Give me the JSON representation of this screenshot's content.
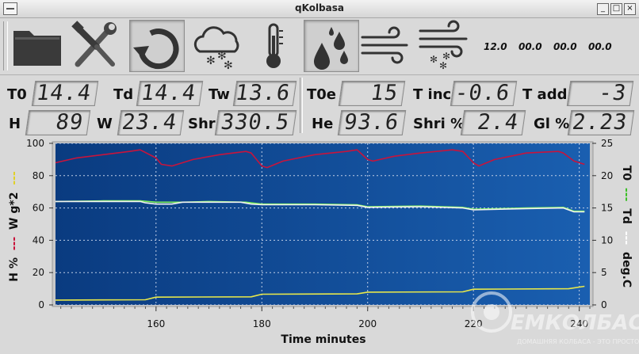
{
  "window": {
    "title": "qKolbasa"
  },
  "toolbar": {
    "buttons": [
      {
        "name": "open",
        "icon": "folder-icon"
      },
      {
        "name": "settings",
        "icon": "tools-icon"
      },
      {
        "name": "refresh",
        "icon": "refresh-icon",
        "pressed": true
      },
      {
        "name": "snow",
        "icon": "snow-cloud-icon"
      },
      {
        "name": "temperature",
        "icon": "thermometer-icon"
      },
      {
        "name": "humidity",
        "icon": "water-drops-icon",
        "pressed": true
      },
      {
        "name": "wind",
        "icon": "wind-icon"
      },
      {
        "name": "wind-snow",
        "icon": "wind-snow-icon"
      }
    ],
    "values": [
      "12.0",
      "00.0",
      "00.0",
      "00.0"
    ]
  },
  "readings": {
    "T0": {
      "label": "T0",
      "value": "14.4"
    },
    "Td": {
      "label": "Td",
      "value": "14.4"
    },
    "Tw": {
      "label": "Tw",
      "value": "13.6"
    },
    "T0e": {
      "label": "T0e",
      "value": "15"
    },
    "Tinc": {
      "label": "T inc",
      "value": "-0.6"
    },
    "Tadd": {
      "label": "T add",
      "value": "-3"
    },
    "H": {
      "label": "H",
      "value": "89"
    },
    "W": {
      "label": "W",
      "value": "23.4"
    },
    "Shr": {
      "label": "Shr",
      "value": "330.5"
    },
    "He": {
      "label": "He",
      "value": "93.6"
    },
    "ShriPct": {
      "label": "Shri %",
      "value": "2.4"
    },
    "GlPct": {
      "label": "Gl %",
      "value": "2.23"
    }
  },
  "colors": {
    "plot_bg": "#0b3f85",
    "humidity": "#c8143c",
    "temperature": "#7bef5a",
    "dew": "#f2f2f2",
    "weight": "#e8e84a"
  },
  "chart_data": {
    "type": "line",
    "xlabel": "Time minutes",
    "ylabel_left": [
      "H %",
      "---",
      "W g*2",
      "---"
    ],
    "ylabel_right": [
      "T0",
      "---",
      "Td",
      "---",
      "deg.C"
    ],
    "xlim": [
      141,
      242
    ],
    "ylim_left": [
      0,
      100
    ],
    "ylim_right": [
      0,
      25
    ],
    "x_ticks": [
      160,
      180,
      200,
      220,
      240
    ],
    "y_ticks_left": [
      0,
      20,
      40,
      60,
      80,
      100
    ],
    "y_ticks_right": [
      0,
      5,
      10,
      15,
      20,
      25
    ],
    "grid": true,
    "series": [
      {
        "key": "humidity",
        "axis": "left",
        "points": [
          [
            141,
            88
          ],
          [
            145,
            91
          ],
          [
            150,
            93
          ],
          [
            155,
            95
          ],
          [
            157,
            96
          ],
          [
            160,
            91
          ],
          [
            161,
            87
          ],
          [
            163,
            86
          ],
          [
            167,
            90
          ],
          [
            172,
            93
          ],
          [
            177,
            95
          ],
          [
            178,
            94
          ],
          [
            180,
            86
          ],
          [
            181,
            85
          ],
          [
            184,
            89
          ],
          [
            190,
            93
          ],
          [
            196,
            95
          ],
          [
            198,
            96
          ],
          [
            200,
            90
          ],
          [
            201,
            89
          ],
          [
            205,
            92
          ],
          [
            210,
            94
          ],
          [
            216,
            96
          ],
          [
            218,
            95
          ],
          [
            220,
            88
          ],
          [
            221,
            86
          ],
          [
            224,
            90
          ],
          [
            230,
            94
          ],
          [
            236,
            95
          ],
          [
            237,
            94
          ],
          [
            239,
            89
          ],
          [
            241,
            87
          ]
        ]
      },
      {
        "key": "temperature",
        "axis": "right",
        "points": [
          [
            141,
            16.0
          ],
          [
            150,
            16.1
          ],
          [
            157,
            16.1
          ],
          [
            160,
            15.9
          ],
          [
            165,
            15.9
          ],
          [
            170,
            16.0
          ],
          [
            177,
            15.9
          ],
          [
            180,
            15.6
          ],
          [
            190,
            15.6
          ],
          [
            198,
            15.5
          ],
          [
            200,
            15.2
          ],
          [
            210,
            15.3
          ],
          [
            218,
            15.1
          ],
          [
            220,
            14.8
          ],
          [
            230,
            15.0
          ],
          [
            237,
            15.1
          ],
          [
            239,
            14.5
          ],
          [
            241,
            14.5
          ]
        ]
      },
      {
        "key": "dew",
        "axis": "right",
        "points": [
          [
            141,
            16.0
          ],
          [
            150,
            16.0
          ],
          [
            157,
            16.0
          ],
          [
            158,
            15.8
          ],
          [
            160,
            15.6
          ],
          [
            163,
            15.6
          ],
          [
            165,
            15.9
          ],
          [
            170,
            15.9
          ],
          [
            176,
            15.9
          ],
          [
            178,
            15.6
          ],
          [
            180,
            15.5
          ],
          [
            190,
            15.5
          ],
          [
            198,
            15.4
          ],
          [
            200,
            15.1
          ],
          [
            210,
            15.2
          ],
          [
            218,
            15.0
          ],
          [
            220,
            14.7
          ],
          [
            230,
            14.9
          ],
          [
            237,
            15.0
          ],
          [
            239,
            14.4
          ],
          [
            241,
            14.4
          ]
        ]
      },
      {
        "key": "weight",
        "axis": "left",
        "points": [
          [
            141,
            3.0
          ],
          [
            158,
            3.2
          ],
          [
            160,
            4.8
          ],
          [
            178,
            5.0
          ],
          [
            180,
            6.6
          ],
          [
            198,
            6.8
          ],
          [
            200,
            7.9
          ],
          [
            218,
            8.1
          ],
          [
            220,
            9.7
          ],
          [
            238,
            10.0
          ],
          [
            241,
            11.5
          ]
        ]
      }
    ]
  },
  "watermark": {
    "line1": "ЕМКОЛБАСКИ",
    "line2": "ДОМАШНЯЯ КОЛБАСА - ЭТО ПРОСТО!"
  }
}
